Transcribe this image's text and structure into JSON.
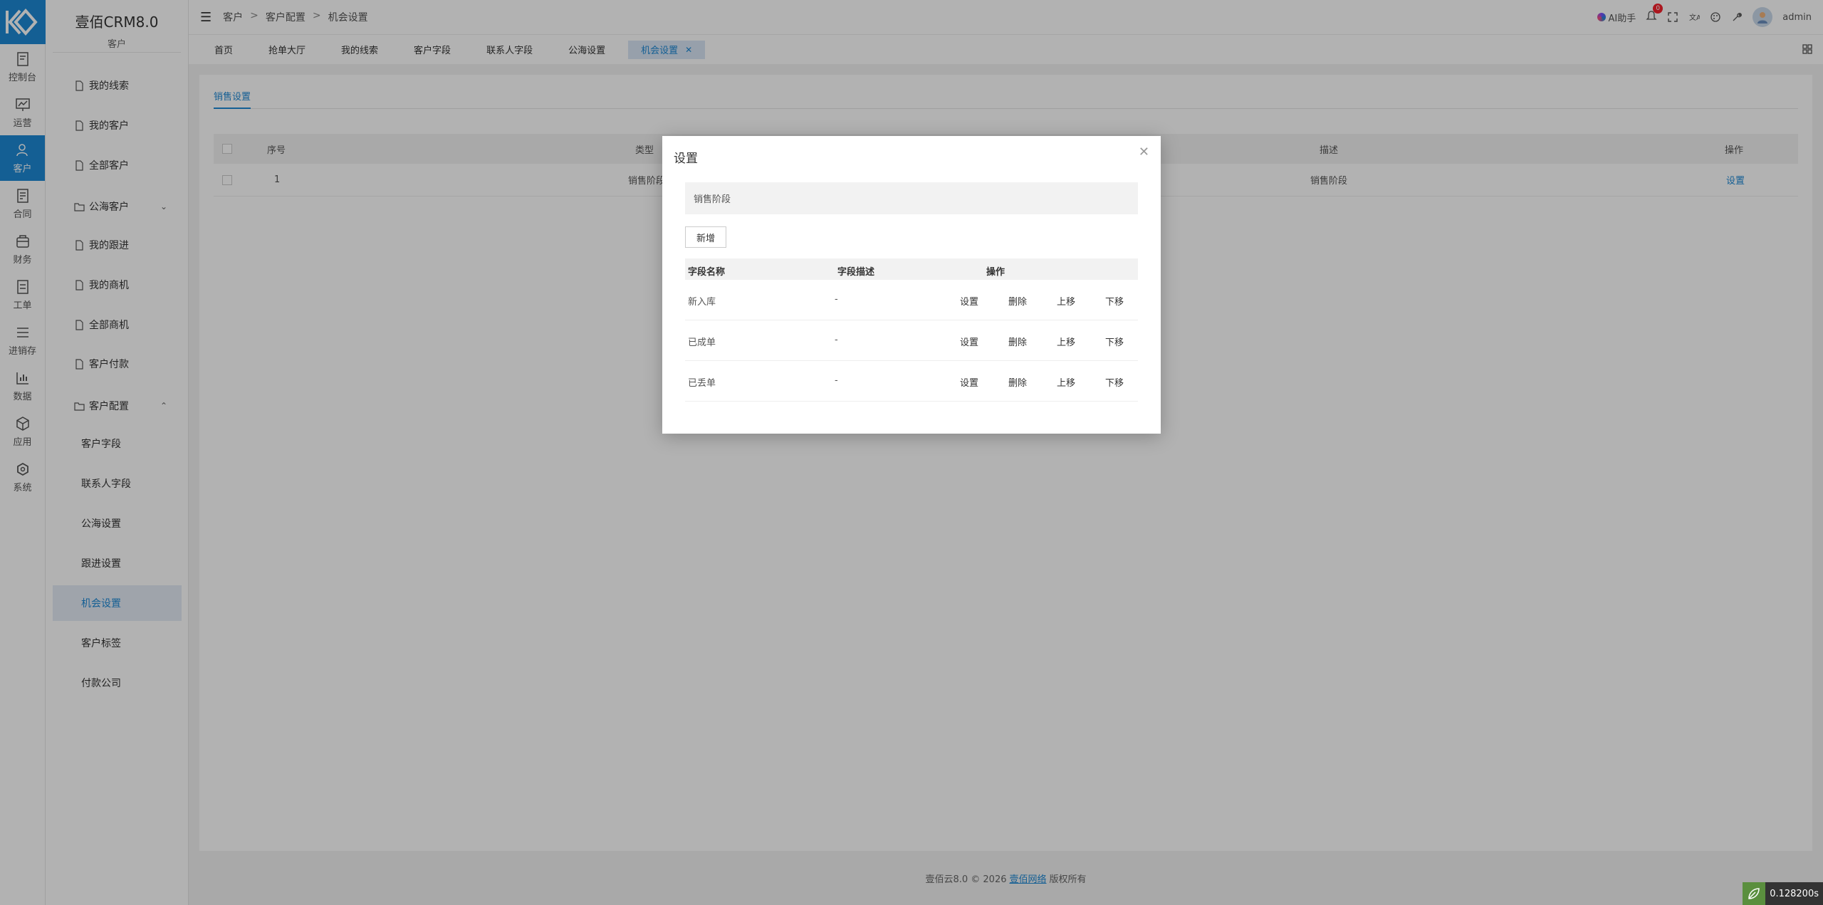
{
  "app": {
    "brand": "壹佰CRM8.0",
    "section": "客户"
  },
  "rail": [
    {
      "label": "控制台",
      "icon": "console-icon"
    },
    {
      "label": "运营",
      "icon": "chart-board-icon"
    },
    {
      "label": "客户",
      "icon": "customer-icon",
      "active": true
    },
    {
      "label": "合同",
      "icon": "contract-icon"
    },
    {
      "label": "财务",
      "icon": "finance-icon"
    },
    {
      "label": "工单",
      "icon": "ticket-icon"
    },
    {
      "label": "进销存",
      "icon": "inventory-icon"
    },
    {
      "label": "数据",
      "icon": "data-icon"
    },
    {
      "label": "应用",
      "icon": "apps-icon"
    },
    {
      "label": "系统",
      "icon": "system-icon"
    }
  ],
  "subnav": {
    "items": [
      "我的线索",
      "我的客户",
      "全部客户",
      "公海客户",
      "我的跟进",
      "我的商机",
      "全部商机",
      "客户付款",
      "客户配置"
    ],
    "sub_items": [
      "客户字段",
      "联系人字段",
      "公海设置",
      "跟进设置",
      "机会设置",
      "客户标签",
      "付款公司"
    ]
  },
  "breadcrumb": [
    "客户",
    "客户配置",
    "机会设置"
  ],
  "topbar": {
    "ai_label": "AI助手",
    "notify_count": "0",
    "user": "admin"
  },
  "tabs": [
    "首页",
    "抢单大厅",
    "我的线索",
    "客户字段",
    "联系人字段",
    "公海设置",
    "机会设置"
  ],
  "inner_tab": "销售设置",
  "table": {
    "headers": {
      "index": "序号",
      "type": "类型",
      "desc": "描述",
      "action": "操作"
    },
    "row": {
      "index": "1",
      "type": "销售阶段",
      "desc": "销售阶段",
      "action": "设置"
    }
  },
  "footer": {
    "prefix": "壹佰云8.0 © 2026",
    "link": "壹佰网络",
    "suffix": "版权所有"
  },
  "modal": {
    "title": "设置",
    "field_label": "销售阶段",
    "add_button": "新增",
    "headers": {
      "name": "字段名称",
      "desc": "字段描述",
      "action": "操作"
    },
    "rows": [
      {
        "name": "新入库",
        "desc": "-"
      },
      {
        "name": "已成单",
        "desc": "-"
      },
      {
        "name": "已丢单",
        "desc": "-"
      }
    ],
    "actions": {
      "set": "设置",
      "delete": "删除",
      "up": "上移",
      "down": "下移"
    }
  },
  "perf": "0.128200s"
}
